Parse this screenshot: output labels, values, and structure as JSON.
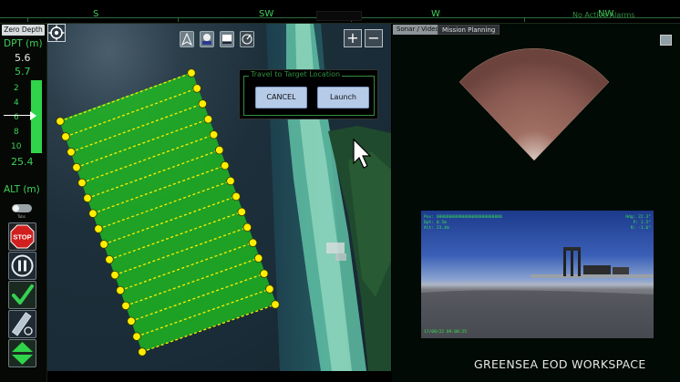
{
  "compass": {
    "headings": [
      {
        "label": "S"
      },
      {
        "label": "SW"
      },
      {
        "label": "W"
      },
      {
        "label": "NW"
      }
    ],
    "alarms_text": "No Active Alarms"
  },
  "left_panel": {
    "zero_depth_label": "Zero Depth",
    "dpt_label": "DPT (m)",
    "dpt_value": "5.6",
    "dpt_target": "5.7",
    "gauge_ticks": [
      "2",
      "4",
      "6",
      "8",
      "10"
    ],
    "dpt_bottom": "25.4",
    "alt_label": "ALT (m)",
    "toggle_label": "Tabs",
    "stop_label": "STOP",
    "colors": {
      "accent": "#3ecf5a",
      "stop": "#d11f1f"
    }
  },
  "map": {
    "tool_icons": [
      "north-arrow-icon",
      "layers-icon",
      "sonar-overlay-icon",
      "heading-icon"
    ],
    "zoom_in_label": "+",
    "zoom_out_label": "−",
    "survey_color": "#1fc21f",
    "waypoint_color": "#ffee00"
  },
  "dialog": {
    "title": "Travel to Target Location",
    "cancel_label": "CANCEL",
    "launch_label": "Launch"
  },
  "right_panel": {
    "tabs": [
      {
        "label": "Sonar / Video",
        "active": true
      },
      {
        "label": "Mission Planning",
        "active": false
      }
    ],
    "video_osd": {
      "pos": "Pos: 00000000000000000000000000",
      "dpt": "Dpt: 0.5m",
      "alt": "Alt: 23.4m",
      "hdg": "Hdg: 22.3°",
      "p": "P: 1.5°",
      "r": "R: -1.6°",
      "date": "17/08/22 09:08:25"
    },
    "workspace_title": "GREENSEA EOD WORKSPACE"
  }
}
